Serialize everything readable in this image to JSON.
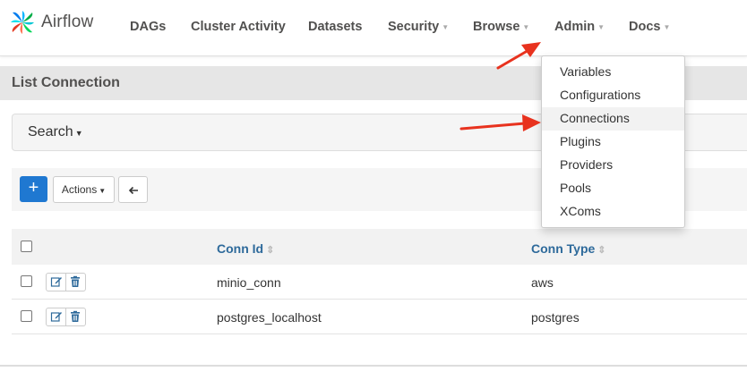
{
  "navbar": {
    "brand": "Airflow",
    "items": [
      {
        "label": "DAGs",
        "dropdown": false
      },
      {
        "label": "Cluster Activity",
        "dropdown": false
      },
      {
        "label": "Datasets",
        "dropdown": false
      },
      {
        "label": "Security",
        "dropdown": true
      },
      {
        "label": "Browse",
        "dropdown": true
      },
      {
        "label": "Admin",
        "dropdown": true
      },
      {
        "label": "Docs",
        "dropdown": true
      }
    ]
  },
  "page": {
    "title": "List Connection",
    "search_label": "Search",
    "actions_label": "Actions"
  },
  "table": {
    "columns": [
      {
        "label": "Conn Id"
      },
      {
        "label": "Conn Type"
      }
    ],
    "rows": [
      {
        "conn_id": "minio_conn",
        "conn_type": "aws"
      },
      {
        "conn_id": "postgres_localhost",
        "conn_type": "postgres"
      }
    ]
  },
  "admin_menu": {
    "items": [
      "Variables",
      "Configurations",
      "Connections",
      "Plugins",
      "Providers",
      "Pools",
      "XComs"
    ],
    "highlighted": "Connections"
  },
  "colors": {
    "primary": "#1f78d1",
    "link": "#2e6a9b",
    "annotation_arrow": "#e8321e"
  }
}
